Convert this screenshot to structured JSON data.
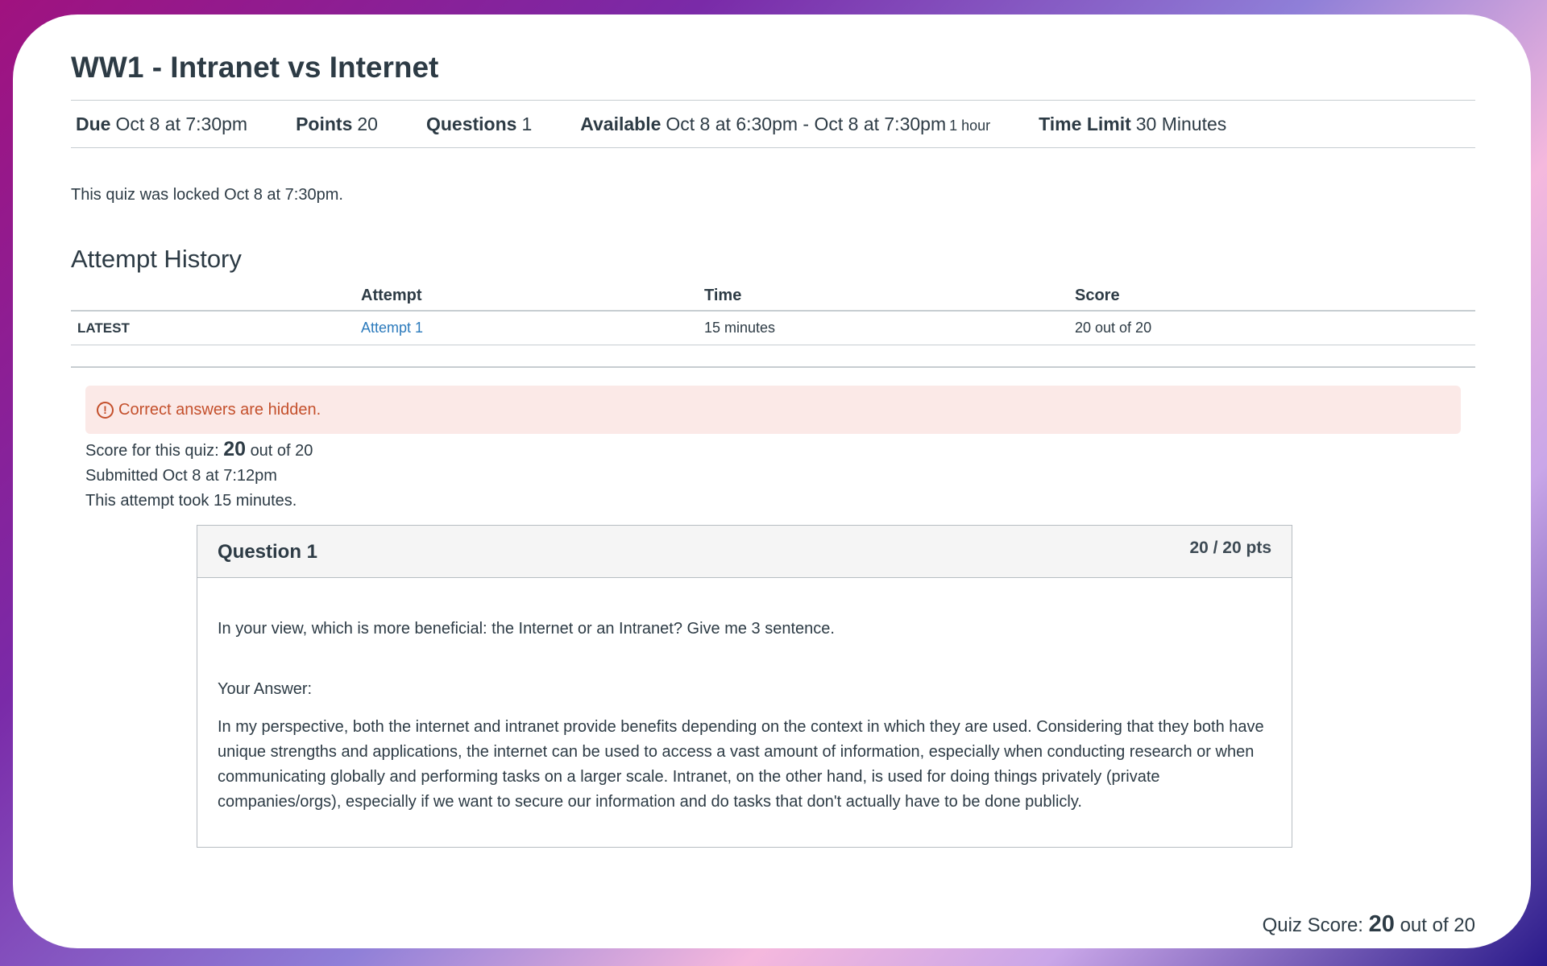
{
  "quiz": {
    "title": "WW1 - Intranet vs Internet",
    "due_label": "Due",
    "due_value": "Oct 8 at 7:30pm",
    "points_label": "Points",
    "points_value": "20",
    "questions_label": "Questions",
    "questions_value": "1",
    "available_label": "Available",
    "available_value": "Oct 8 at 6:30pm - Oct 8 at 7:30pm",
    "available_duration": "1 hour",
    "time_limit_label": "Time Limit",
    "time_limit_value": "30 Minutes",
    "locked_message": "This quiz was locked Oct 8 at 7:30pm."
  },
  "history": {
    "heading": "Attempt History",
    "columns": [
      "",
      "Attempt",
      "Time",
      "Score"
    ],
    "rows": [
      {
        "tag": "LATEST",
        "attempt": "Attempt 1",
        "time": "15 minutes",
        "score": "20 out of 20"
      }
    ]
  },
  "submission": {
    "alert_icon": "!",
    "alert": "Correct answers are hidden.",
    "score_prefix": "Score for this quiz:",
    "score_value": "20",
    "score_suffix": "out of 20",
    "submitted": "Submitted Oct 8 at 7:12pm",
    "duration": "This attempt took 15 minutes."
  },
  "question": {
    "title": "Question 1",
    "points": "20 / 20 pts",
    "text": "In your view, which is more beneficial: the Internet or an Intranet? Give me 3 sentence.",
    "answer_label": "Your Answer:",
    "answer": "In my perspective, both the internet and intranet provide benefits depending on the context in which they are used. Considering that they both have unique strengths and applications, the internet can be used to access a vast amount of information, especially when conducting research or when communicating globally and performing tasks on a larger scale. Intranet, on the other hand, is used for doing things privately (private companies/orgs), especially if we want to secure our information and do tasks that don't actually have to be done publicly."
  },
  "footer": {
    "prefix": "Quiz Score:",
    "value": "20",
    "suffix": "out of 20"
  },
  "colors": {
    "link": "#2b7abc",
    "alert_text": "#c4502c",
    "alert_bg": "#fbe9e7",
    "text": "#2d3b45"
  }
}
